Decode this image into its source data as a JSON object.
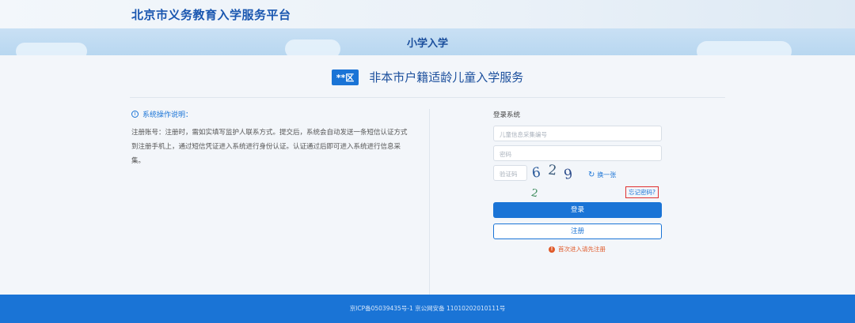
{
  "header": {
    "site_title": "北京市义务教育入学服务平台"
  },
  "banner": {
    "title": "小学入学"
  },
  "service": {
    "district_badge": "**区",
    "title": "非本市户籍适龄儿童入学服务"
  },
  "instructions": {
    "heading": "系统操作说明：",
    "text": "注册账号：注册时，需如实填写监护人联系方式。提交后，系统会自动发送一条短信认证方式到注册手机上，通过短信凭证进入系统进行身份认证。认证通过后即可进入系统进行信息采集。"
  },
  "login": {
    "title": "登录系统",
    "id_placeholder": "儿童信息采集编号",
    "password_placeholder": "密码",
    "captcha_placeholder": "验证码",
    "captcha_chars": [
      "6",
      "2",
      "9",
      "2"
    ],
    "refresh_label": "换一张",
    "forgot_label": "忘记密码?",
    "login_button": "登录",
    "register_button": "注册",
    "notice": "首次进入请先注册"
  },
  "footer": {
    "text": "京ICP备05039435号-1 京公网安备 11010202010111号"
  },
  "colors": {
    "primary": "#1a74d6",
    "header_text": "#1a57b0",
    "warning": "#e05a2a",
    "highlight_border": "#e03030"
  }
}
